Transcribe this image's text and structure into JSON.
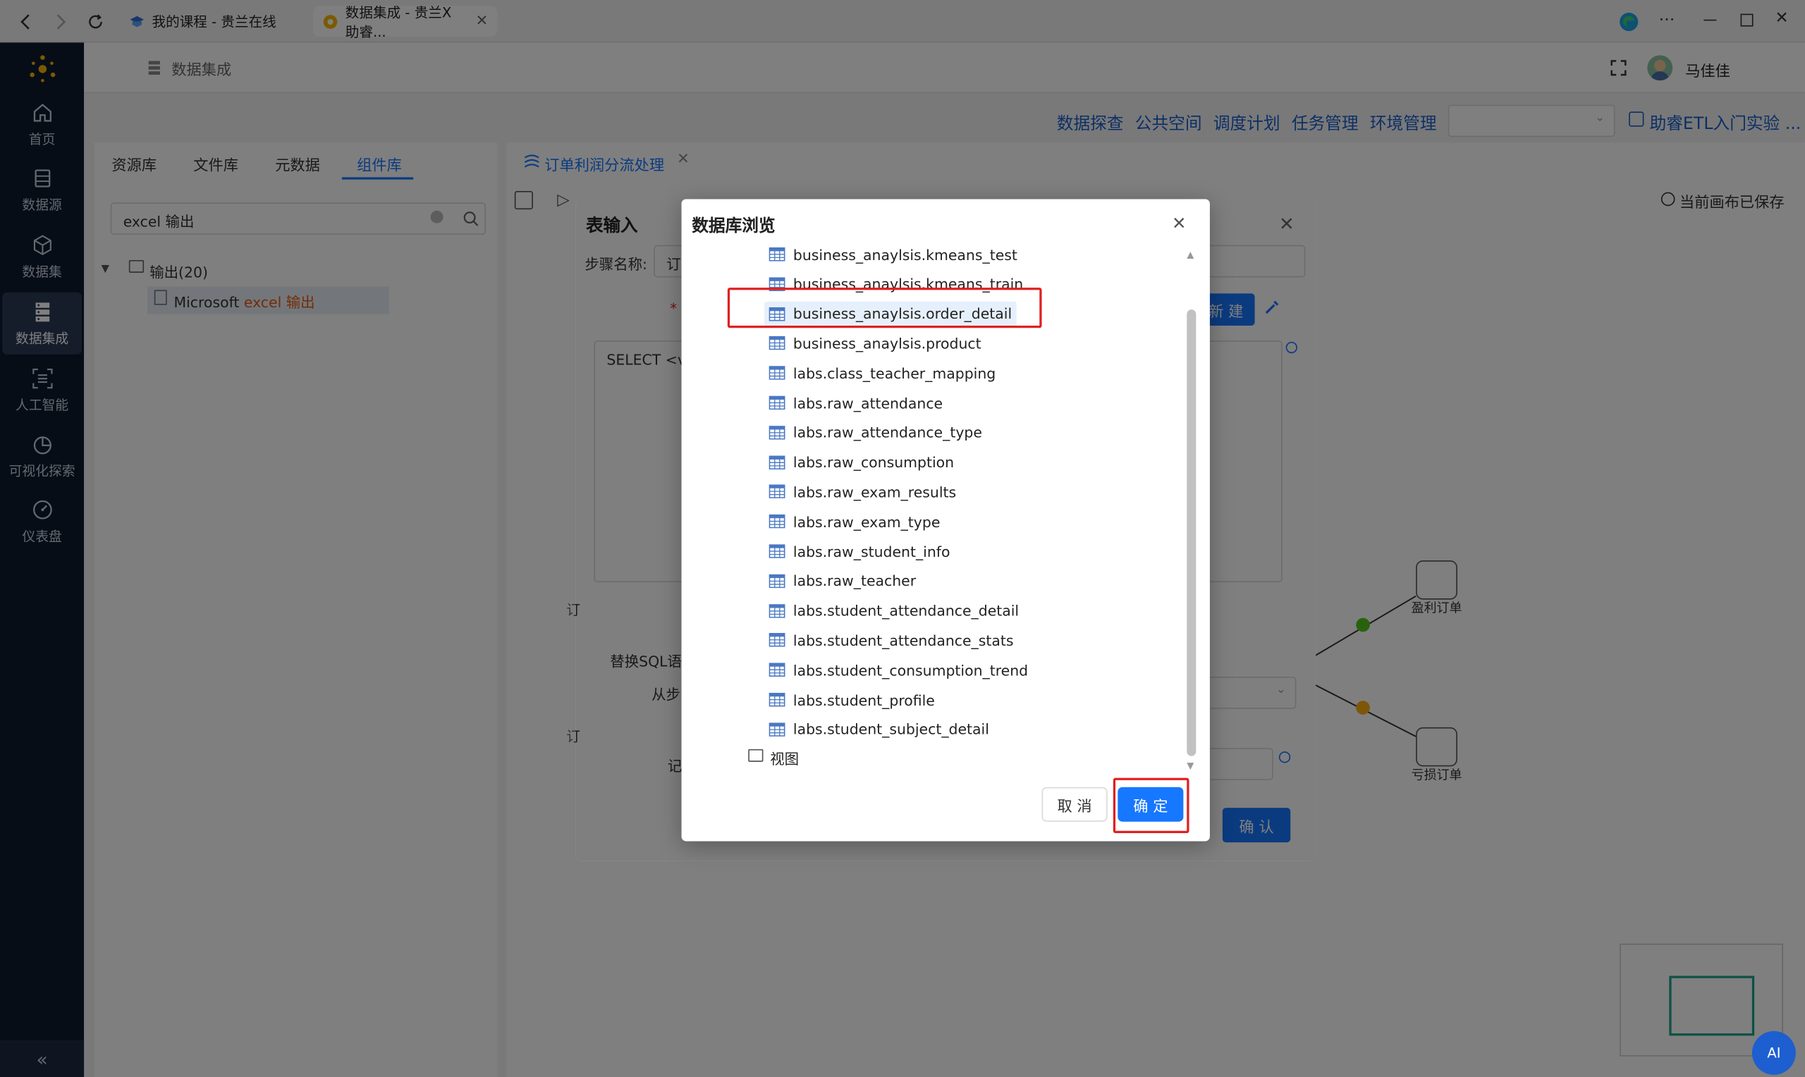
{
  "browser": {
    "tabs": [
      {
        "label": "我的课程 - 贵兰在线",
        "active": false
      },
      {
        "label": "数据集成 - 贵兰X助睿...",
        "active": true
      }
    ]
  },
  "sidebar": {
    "items": [
      {
        "label": "首页",
        "icon": "home-icon"
      },
      {
        "label": "数据源",
        "icon": "database-icon"
      },
      {
        "label": "数据集",
        "icon": "cube-icon"
      },
      {
        "label": "数据集成",
        "icon": "server-stack-icon",
        "active": true
      },
      {
        "label": "人工智能",
        "icon": "ai-scan-icon"
      },
      {
        "label": "可视化探索",
        "icon": "pie-chart-icon"
      },
      {
        "label": "仪表盘",
        "icon": "gauge-icon"
      }
    ],
    "collapse": "«"
  },
  "header": {
    "breadcrumb": "数据集成",
    "user": "马佳佳"
  },
  "topnav": {
    "links": [
      "数据探查",
      "公共空间",
      "调度计划",
      "任务管理",
      "环境管理"
    ],
    "project": "助睿ETL入门实验 ..."
  },
  "leftpanel": {
    "tabs": [
      "资源库",
      "文件库",
      "元数据",
      "组件库"
    ],
    "active_tab": "组件库",
    "search_value": "excel 输出",
    "tree_folder": "输出(20)",
    "tree_item_prefix": "Microsoft ",
    "tree_item_highlight": "excel 输出"
  },
  "canvas": {
    "tab_label": "订单利润分流处理",
    "saved_status": "当前画布已保存",
    "node_profit": "盈利订单",
    "node_loss": "亏损订单"
  },
  "table_input_dialog": {
    "title": "表输入",
    "step_name_label": "步骤名称:",
    "step_name_value": "订",
    "new_button": "新 建",
    "sql_text": "SELECT <va",
    "replace_sql_label": "替换SQL语",
    "from_step_label": "从步",
    "record_label": "记",
    "confirm_button": "确 认",
    "side_label_1": "订",
    "side_label_2": "订"
  },
  "db_browser": {
    "title": "数据库浏览",
    "tables": [
      "business_anaylsis.kmeans_test",
      "business_anaylsis.kmeans_train",
      "business_anaylsis.order_detail",
      "business_anaylsis.product",
      "labs.class_teacher_mapping",
      "labs.raw_attendance",
      "labs.raw_attendance_type",
      "labs.raw_consumption",
      "labs.raw_exam_results",
      "labs.raw_exam_type",
      "labs.raw_student_info",
      "labs.raw_teacher",
      "labs.student_attendance_detail",
      "labs.student_attendance_stats",
      "labs.student_consumption_trend",
      "labs.student_profile",
      "labs.student_subject_detail"
    ],
    "selected": "business_anaylsis.order_detail",
    "views_folder": "视图",
    "cancel_button": "取 消",
    "ok_button": "确 定"
  },
  "ai_badge": "AI",
  "colors": {
    "primary": "#1677ff",
    "sidebar_bg": "#0e1a2f",
    "highlight": "#e02020"
  }
}
